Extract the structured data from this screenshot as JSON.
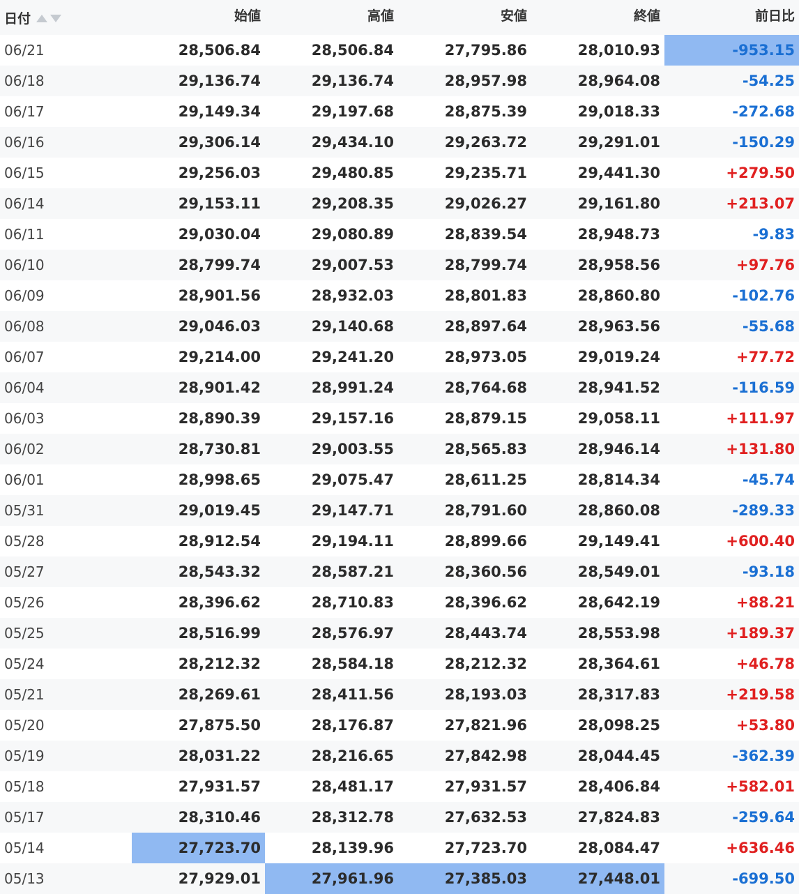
{
  "headers": {
    "date": "日付",
    "open": "始値",
    "high": "高値",
    "low": "安値",
    "close": "終値",
    "change": "前日比"
  },
  "colors": {
    "positive": "#e02020",
    "negative": "#1a6fd3",
    "highlight": "#90b9f2",
    "stripe": "#f7f8f9"
  },
  "highlighted_cells": [
    {
      "row": 0,
      "column": "change"
    },
    {
      "row": 26,
      "column": "open"
    },
    {
      "row": 27,
      "column": "high"
    },
    {
      "row": 27,
      "column": "low"
    },
    {
      "row": 27,
      "column": "close"
    }
  ],
  "rows": [
    {
      "date": "06/21",
      "open": "28,506.84",
      "high": "28,506.84",
      "low": "27,795.86",
      "close": "28,010.93",
      "change": "-953.15"
    },
    {
      "date": "06/18",
      "open": "29,136.74",
      "high": "29,136.74",
      "low": "28,957.98",
      "close": "28,964.08",
      "change": "-54.25"
    },
    {
      "date": "06/17",
      "open": "29,149.34",
      "high": "29,197.68",
      "low": "28,875.39",
      "close": "29,018.33",
      "change": "-272.68"
    },
    {
      "date": "06/16",
      "open": "29,306.14",
      "high": "29,434.10",
      "low": "29,263.72",
      "close": "29,291.01",
      "change": "-150.29"
    },
    {
      "date": "06/15",
      "open": "29,256.03",
      "high": "29,480.85",
      "low": "29,235.71",
      "close": "29,441.30",
      "change": "+279.50"
    },
    {
      "date": "06/14",
      "open": "29,153.11",
      "high": "29,208.35",
      "low": "29,026.27",
      "close": "29,161.80",
      "change": "+213.07"
    },
    {
      "date": "06/11",
      "open": "29,030.04",
      "high": "29,080.89",
      "low": "28,839.54",
      "close": "28,948.73",
      "change": "-9.83"
    },
    {
      "date": "06/10",
      "open": "28,799.74",
      "high": "29,007.53",
      "low": "28,799.74",
      "close": "28,958.56",
      "change": "+97.76"
    },
    {
      "date": "06/09",
      "open": "28,901.56",
      "high": "28,932.03",
      "low": "28,801.83",
      "close": "28,860.80",
      "change": "-102.76"
    },
    {
      "date": "06/08",
      "open": "29,046.03",
      "high": "29,140.68",
      "low": "28,897.64",
      "close": "28,963.56",
      "change": "-55.68"
    },
    {
      "date": "06/07",
      "open": "29,214.00",
      "high": "29,241.20",
      "low": "28,973.05",
      "close": "29,019.24",
      "change": "+77.72"
    },
    {
      "date": "06/04",
      "open": "28,901.42",
      "high": "28,991.24",
      "low": "28,764.68",
      "close": "28,941.52",
      "change": "-116.59"
    },
    {
      "date": "06/03",
      "open": "28,890.39",
      "high": "29,157.16",
      "low": "28,879.15",
      "close": "29,058.11",
      "change": "+111.97"
    },
    {
      "date": "06/02",
      "open": "28,730.81",
      "high": "29,003.55",
      "low": "28,565.83",
      "close": "28,946.14",
      "change": "+131.80"
    },
    {
      "date": "06/01",
      "open": "28,998.65",
      "high": "29,075.47",
      "low": "28,611.25",
      "close": "28,814.34",
      "change": "-45.74"
    },
    {
      "date": "05/31",
      "open": "29,019.45",
      "high": "29,147.71",
      "low": "28,791.60",
      "close": "28,860.08",
      "change": "-289.33"
    },
    {
      "date": "05/28",
      "open": "28,912.54",
      "high": "29,194.11",
      "low": "28,899.66",
      "close": "29,149.41",
      "change": "+600.40"
    },
    {
      "date": "05/27",
      "open": "28,543.32",
      "high": "28,587.21",
      "low": "28,360.56",
      "close": "28,549.01",
      "change": "-93.18"
    },
    {
      "date": "05/26",
      "open": "28,396.62",
      "high": "28,710.83",
      "low": "28,396.62",
      "close": "28,642.19",
      "change": "+88.21"
    },
    {
      "date": "05/25",
      "open": "28,516.99",
      "high": "28,576.97",
      "low": "28,443.74",
      "close": "28,553.98",
      "change": "+189.37"
    },
    {
      "date": "05/24",
      "open": "28,212.32",
      "high": "28,584.18",
      "low": "28,212.32",
      "close": "28,364.61",
      "change": "+46.78"
    },
    {
      "date": "05/21",
      "open": "28,269.61",
      "high": "28,411.56",
      "low": "28,193.03",
      "close": "28,317.83",
      "change": "+219.58"
    },
    {
      "date": "05/20",
      "open": "27,875.50",
      "high": "28,176.87",
      "low": "27,821.96",
      "close": "28,098.25",
      "change": "+53.80"
    },
    {
      "date": "05/19",
      "open": "28,031.22",
      "high": "28,216.65",
      "low": "27,842.98",
      "close": "28,044.45",
      "change": "-362.39"
    },
    {
      "date": "05/18",
      "open": "27,931.57",
      "high": "28,481.17",
      "low": "27,931.57",
      "close": "28,406.84",
      "change": "+582.01"
    },
    {
      "date": "05/17",
      "open": "28,310.46",
      "high": "28,312.78",
      "low": "27,632.53",
      "close": "27,824.83",
      "change": "-259.64"
    },
    {
      "date": "05/14",
      "open": "27,723.70",
      "high": "28,139.96",
      "low": "27,723.70",
      "close": "28,084.47",
      "change": "+636.46"
    },
    {
      "date": "05/13",
      "open": "27,929.01",
      "high": "27,961.96",
      "low": "27,385.03",
      "close": "27,448.01",
      "change": "-699.50"
    }
  ]
}
